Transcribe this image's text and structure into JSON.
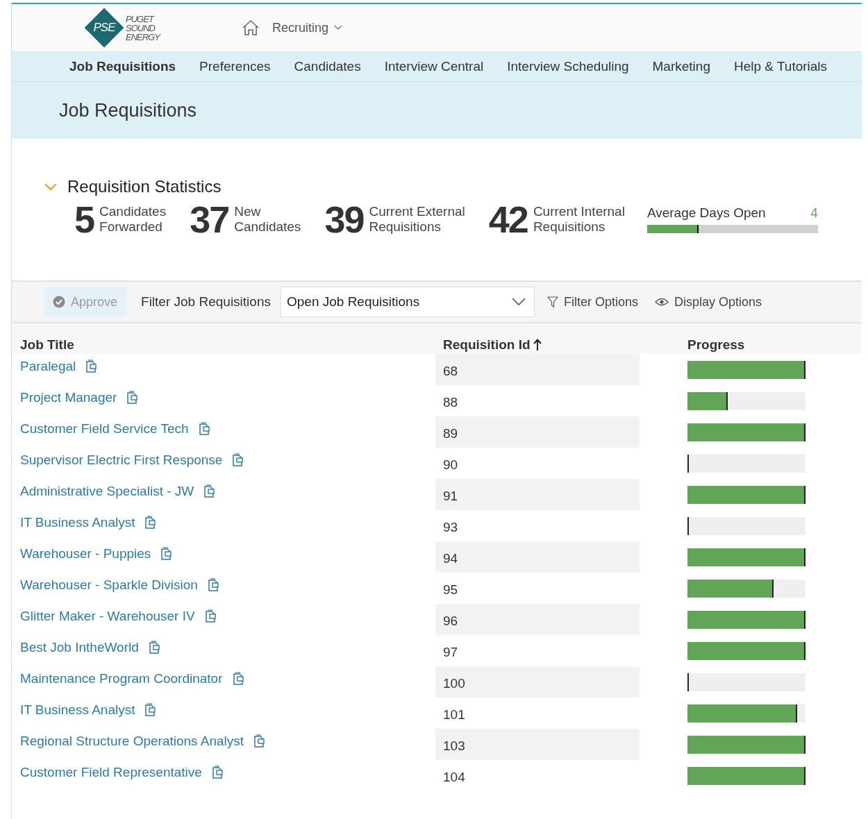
{
  "header": {
    "logo_mark": "PSE",
    "logo_words": [
      "PUGET",
      "SOUND",
      "ENERGY"
    ],
    "module": "Recruiting"
  },
  "nav": [
    {
      "label": "Job Requisitions",
      "selected": true
    },
    {
      "label": "Preferences",
      "selected": false
    },
    {
      "label": "Candidates",
      "selected": false
    },
    {
      "label": "Interview Central",
      "selected": false
    },
    {
      "label": "Interview Scheduling",
      "selected": false
    },
    {
      "label": "Marketing",
      "selected": false
    },
    {
      "label": "Help & Tutorials",
      "selected": false
    }
  ],
  "page_title": "Job Requisitions",
  "statistics": {
    "title": "Requisition Statistics",
    "expanded": true,
    "items": [
      {
        "number": "5",
        "label": [
          "Candidates",
          "Forwarded"
        ]
      },
      {
        "number": "37",
        "label": [
          "New",
          "Candidates"
        ]
      },
      {
        "number": "39",
        "label": [
          "Current External",
          "Requisitions"
        ]
      },
      {
        "number": "42",
        "label": [
          "Current Internal",
          "Requisitions"
        ]
      }
    ],
    "average": {
      "label": "Average Days Open",
      "value": "4",
      "level": 0.3
    }
  },
  "toolbar": {
    "approve": {
      "label": "Approve",
      "disabled": true
    },
    "filter_label": "Filter Job Requisitions",
    "filter_value": "Open Job Requisitions",
    "filter_options": "Filter Options",
    "display_options": "Display Options"
  },
  "table": {
    "columns": [
      {
        "label": "Job Title",
        "sorted": false
      },
      {
        "label": "Requisition Id",
        "sorted": true
      },
      {
        "label": "Progress",
        "sorted": false
      }
    ],
    "rows": [
      {
        "title": "Paralegal",
        "id": "68",
        "level": 1
      },
      {
        "title": "Project Manager",
        "id": "88",
        "level": 0.34
      },
      {
        "title": "Customer Field Service Tech",
        "id": "89",
        "level": 1
      },
      {
        "title": "Supervisor Electric First Response",
        "id": "90",
        "level": 0
      },
      {
        "title": "Administrative Specialist - JW",
        "id": "91",
        "level": 1
      },
      {
        "title": "IT Business Analyst",
        "id": "93",
        "level": 0
      },
      {
        "title": "Warehouser - Puppies",
        "id": "94",
        "level": 1
      },
      {
        "title": "Warehouser - Sparkle Division",
        "id": "95",
        "level": 0.73
      },
      {
        "title": "Glitter Maker - Warehouser IV",
        "id": "96",
        "level": 1
      },
      {
        "title": "Best Job IntheWorld",
        "id": "97",
        "level": 1
      },
      {
        "title": "Maintenance Program Coordinator",
        "id": "100",
        "level": 0
      },
      {
        "title": "IT Business Analyst",
        "id": "101",
        "level": 0.93
      },
      {
        "title": "Regional Structure Operations Analyst",
        "id": "103",
        "level": 1
      },
      {
        "title": "Customer Field Representative",
        "id": "104",
        "level": 1
      }
    ]
  }
}
